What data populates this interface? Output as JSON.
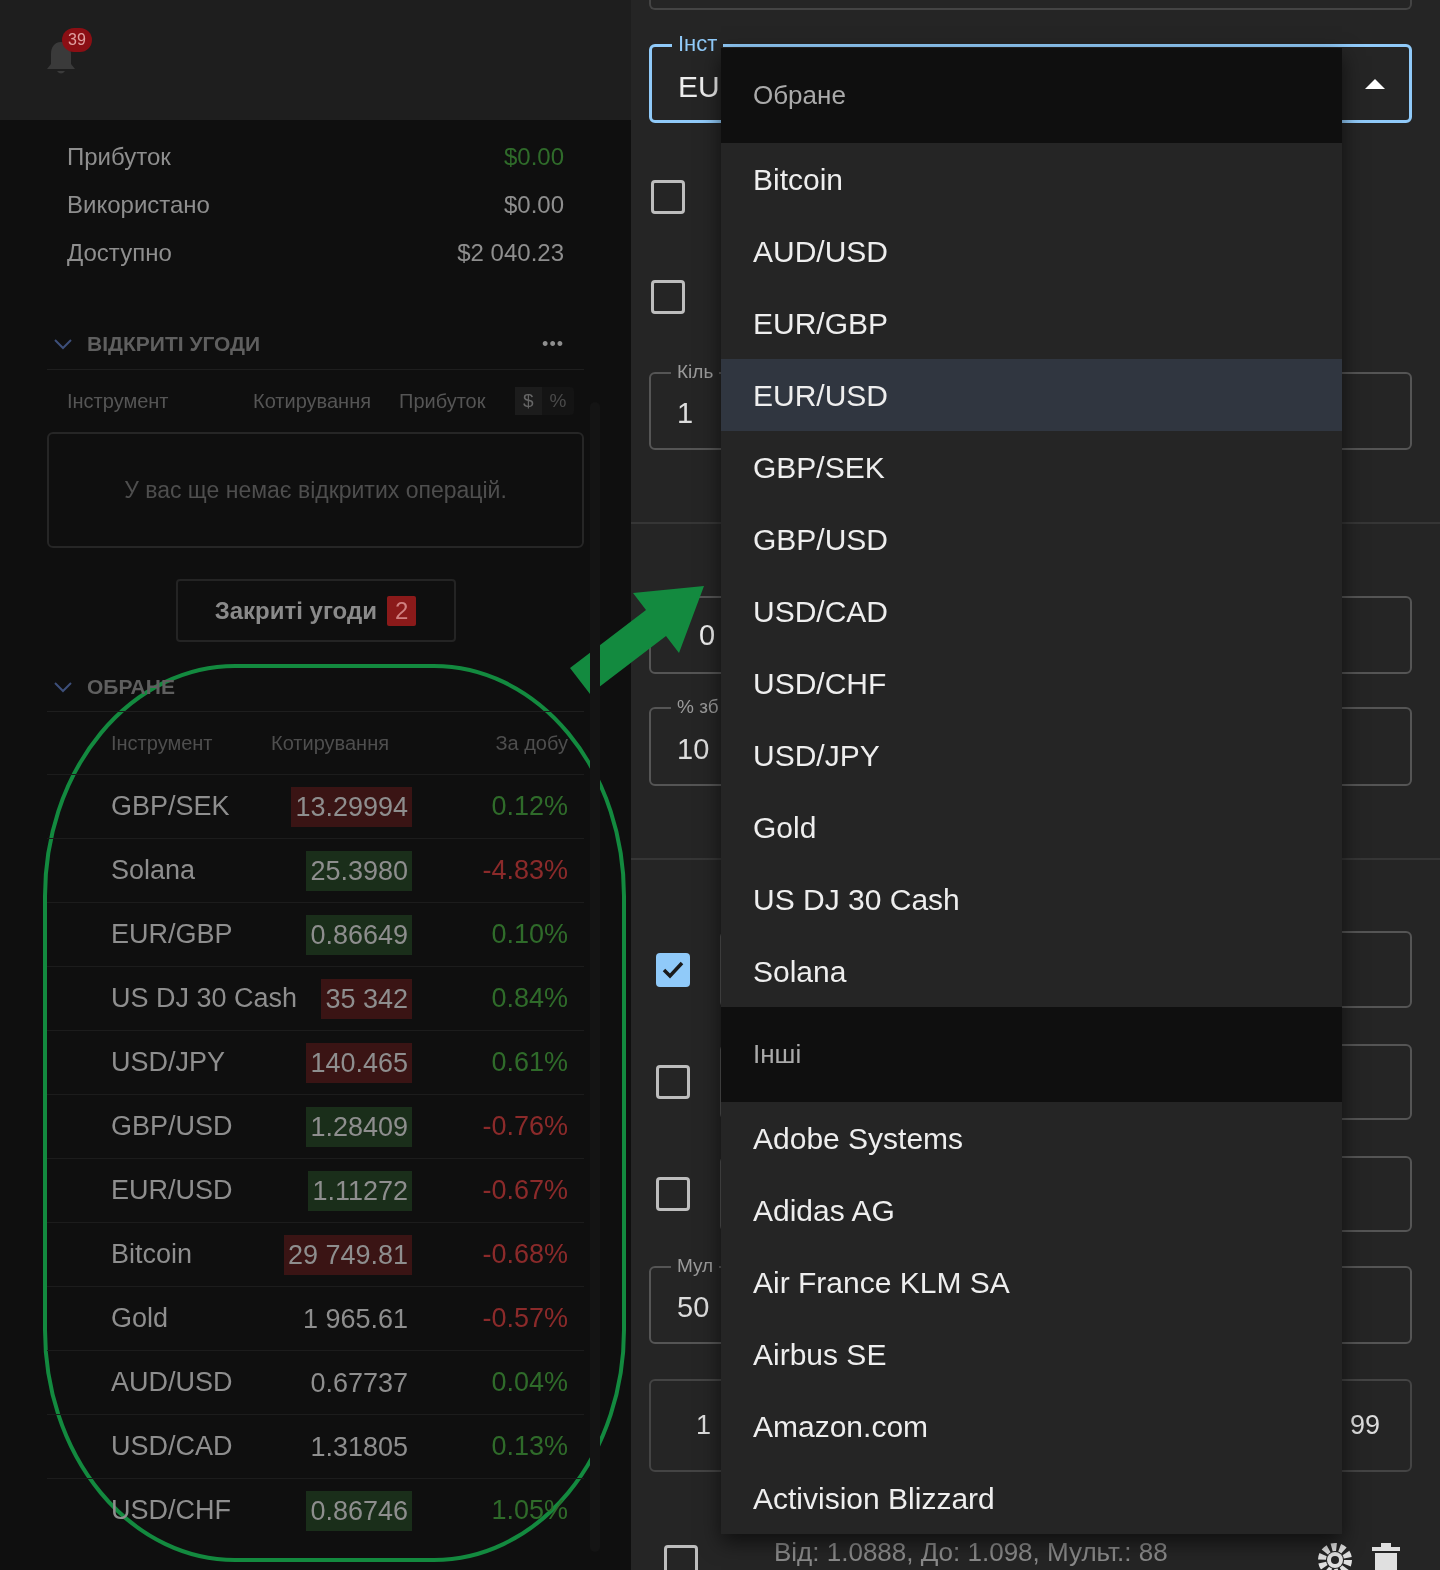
{
  "notifications": {
    "count": "39"
  },
  "summary": [
    {
      "label": "Прибуток",
      "value": "$0.00",
      "color": "#2f6b2a"
    },
    {
      "label": "Використано",
      "value": "$0.00",
      "color": "#8e8e8e"
    },
    {
      "label": "Доступно",
      "value": "$2 040.23",
      "color": "#8e8e8e"
    }
  ],
  "open_trades": {
    "title": "ВІДКРИТІ УГОДИ",
    "expanded": true,
    "more": "•••",
    "columns": [
      "Інструмент",
      "Котирування",
      "Прибуток"
    ],
    "units": [
      {
        "label": "$",
        "selected": true
      },
      {
        "label": "%",
        "selected": false
      }
    ],
    "empty_message": "У вас ще немає відкритих операцій."
  },
  "closed_trades_button": {
    "label": "Закриті угоди",
    "count": "2"
  },
  "favorites": {
    "title": "ОБРАНЕ",
    "expanded": true,
    "columns": [
      "Інструмент",
      "Котирування",
      "За добу"
    ],
    "rows": [
      {
        "instrument": "GBP/SEK",
        "quote": {
          "text": "13.29994",
          "color": "#3a1414"
        },
        "change": {
          "text": "0.12%",
          "color": "#2f6b2a"
        }
      },
      {
        "instrument": "Solana",
        "quote": {
          "text": "25.3980",
          "color": "#1a2e1a"
        },
        "change": {
          "text": "-4.83%",
          "color": "#8b2a2a"
        }
      },
      {
        "instrument": "EUR/GBP",
        "quote": {
          "text": "0.86649",
          "color": "#1a2e1a"
        },
        "change": {
          "text": "0.10%",
          "color": "#2f6b2a"
        }
      },
      {
        "instrument": "US DJ 30 Cash",
        "quote": {
          "text": "35 342",
          "color": "#3a1414"
        },
        "change": {
          "text": "0.84%",
          "color": "#2f6b2a"
        }
      },
      {
        "instrument": "USD/JPY",
        "quote": {
          "text": "140.465",
          "color": "#3a1414"
        },
        "change": {
          "text": "0.61%",
          "color": "#2f6b2a"
        }
      },
      {
        "instrument": "GBP/USD",
        "quote": {
          "text": "1.28409",
          "color": "#1a2e1a"
        },
        "change": {
          "text": "-0.76%",
          "color": "#8b2a2a"
        }
      },
      {
        "instrument": "EUR/USD",
        "quote": {
          "text": "1.11272",
          "color": "#1a2e1a"
        },
        "change": {
          "text": "-0.67%",
          "color": "#8b2a2a"
        }
      },
      {
        "instrument": "Bitcoin",
        "quote": {
          "text": "29 749.81",
          "color": "#3a1414"
        },
        "change": {
          "text": "-0.68%",
          "color": "#8b2a2a"
        }
      },
      {
        "instrument": "Gold",
        "quote": {
          "text": "1 965.61"
        },
        "change": {
          "text": "-0.57%",
          "color": "#8b2a2a"
        }
      },
      {
        "instrument": "AUD/USD",
        "quote": {
          "text": "0.67737"
        },
        "change": {
          "text": "0.04%",
          "color": "#2f6b2a"
        }
      },
      {
        "instrument": "USD/CAD",
        "quote": {
          "text": "1.31805"
        },
        "change": {
          "text": "0.13%",
          "color": "#2f6b2a"
        }
      },
      {
        "instrument": "USD/CHF",
        "quote": {
          "text": "0.86746",
          "color": "#1a2e1a"
        },
        "change": {
          "text": "1.05%",
          "color": "#2f6b2a"
        }
      }
    ]
  },
  "form": {
    "items": [
      {
        "kind": "select",
        "label": "Інст",
        "value": "EU",
        "open": true
      },
      {
        "kind": "checkbox",
        "checked": false
      },
      {
        "kind": "checkbox",
        "checked": false
      },
      {
        "kind": "field",
        "label": "Кіль",
        "value": "1"
      },
      {
        "kind": "divider"
      },
      {
        "kind": "field",
        "value": "0"
      },
      {
        "kind": "field",
        "label": "% зб",
        "value": "10"
      },
      {
        "kind": "divider"
      },
      {
        "kind": "checkbox_field",
        "checked": true
      },
      {
        "kind": "checkbox_field",
        "checked": false
      },
      {
        "kind": "checkbox_field",
        "checked": false
      },
      {
        "kind": "field",
        "label": "Мул",
        "value": "50"
      },
      {
        "kind": "range",
        "from": "1",
        "to": "99"
      }
    ],
    "footer": {
      "checked": false,
      "text": "Від: 1.0888, До: 1.098, Мульт.: 88"
    }
  },
  "dropdown": {
    "groups": [
      {
        "title": "Обране",
        "items": [
          {
            "label": "Bitcoin",
            "selected": false
          },
          {
            "label": "AUD/USD",
            "selected": false
          },
          {
            "label": "EUR/GBP",
            "selected": false
          },
          {
            "label": "EUR/USD",
            "selected": true
          },
          {
            "label": "GBP/SEK",
            "selected": false
          },
          {
            "label": "GBP/USD",
            "selected": false
          },
          {
            "label": "USD/CAD",
            "selected": false
          },
          {
            "label": "USD/CHF",
            "selected": false
          },
          {
            "label": "USD/JPY",
            "selected": false
          },
          {
            "label": "Gold",
            "selected": false
          },
          {
            "label": "US DJ 30 Cash",
            "selected": false
          },
          {
            "label": "Solana",
            "selected": false
          }
        ]
      },
      {
        "title": "Інші",
        "items": [
          {
            "label": "Adobe Systems",
            "selected": false
          },
          {
            "label": "Adidas AG",
            "selected": false
          },
          {
            "label": "Air France KLM SA",
            "selected": false
          },
          {
            "label": "Airbus SE",
            "selected": false
          },
          {
            "label": "Amazon.com",
            "selected": false
          },
          {
            "label": "Activision Blizzard",
            "selected": false
          }
        ]
      }
    ]
  }
}
